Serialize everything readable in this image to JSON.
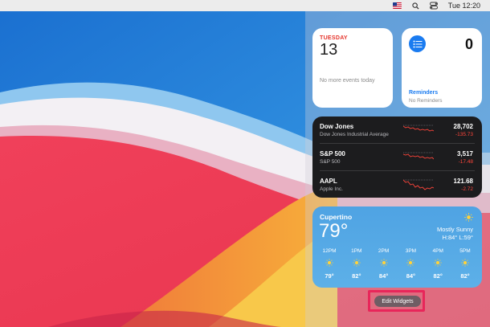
{
  "menubar": {
    "flag": "us-flag-icon",
    "search_icon": "search-icon",
    "control_icon": "control-center-icon",
    "clock": "Tue 12:20"
  },
  "calendar_widget": {
    "day_of_week": "TUESDAY",
    "date": "13",
    "events_text": "No more events today"
  },
  "reminders_widget": {
    "icon": "list-bullet-icon",
    "count": "0",
    "title": "Reminders",
    "subtitle": "No Reminders"
  },
  "stocks_widget": {
    "rows": [
      {
        "symbol": "Dow Jones",
        "name": "Dow Jones Industrial Average",
        "price": "28,702",
        "change": "-135.73"
      },
      {
        "symbol": "S&P 500",
        "name": "S&P 500",
        "price": "3,517",
        "change": "-17.48"
      },
      {
        "symbol": "AAPL",
        "name": "Apple Inc.",
        "price": "121.68",
        "change": "-2.72"
      }
    ],
    "negative_color": "#ff453a"
  },
  "weather_widget": {
    "city": "Cupertino",
    "temperature": "79°",
    "condition": "Mostly Sunny",
    "high_low": "H:84° L:59°",
    "icon": "sun-icon",
    "forecast": [
      {
        "hour": "12PM",
        "temp": "79°",
        "icon": "sun-icon"
      },
      {
        "hour": "1PM",
        "temp": "82°",
        "icon": "sun-icon"
      },
      {
        "hour": "2PM",
        "temp": "84°",
        "icon": "sun-icon"
      },
      {
        "hour": "3PM",
        "temp": "84°",
        "icon": "sun-icon"
      },
      {
        "hour": "4PM",
        "temp": "82°",
        "icon": "sun-icon"
      },
      {
        "hour": "5PM",
        "temp": "82°",
        "icon": "sun-icon"
      }
    ]
  },
  "edit_widgets_label": "Edit Widgets",
  "highlight_color": "#e8265a"
}
